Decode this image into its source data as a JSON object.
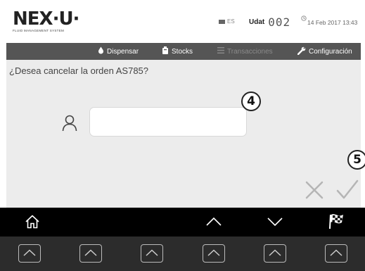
{
  "header": {
    "logo_text": "NEX·U·",
    "logo_subtitle": "FLUID MANAGEMENT SYSTEM",
    "language": "ES",
    "udat_label": "Udat",
    "udat_number": "002",
    "datetime": "14 Feb 2017 13:43"
  },
  "nav": {
    "items": [
      {
        "label": "Dispensar",
        "icon": "drop-icon",
        "enabled": true
      },
      {
        "label": "Stocks",
        "icon": "tank-icon",
        "enabled": true
      },
      {
        "label": "Transacciones",
        "icon": "list-icon",
        "enabled": false
      },
      {
        "label": "Configuración",
        "icon": "wrench-icon",
        "enabled": true
      }
    ]
  },
  "dialog": {
    "question": "¿Desea cancelar la orden AS785?",
    "input_value": "",
    "input_placeholder": ""
  },
  "callouts": {
    "input": "4",
    "confirm": "5"
  },
  "footer": {
    "icons": [
      "home-icon",
      "up-arrow-icon",
      "down-arrow-icon",
      "checkered-flag-icon"
    ],
    "softkeys_count": 6
  },
  "colors": {
    "navbar": "#555555",
    "content_bg": "#ececec",
    "footer_top": "#000000",
    "footer_bottom": "#2c2c2c"
  }
}
